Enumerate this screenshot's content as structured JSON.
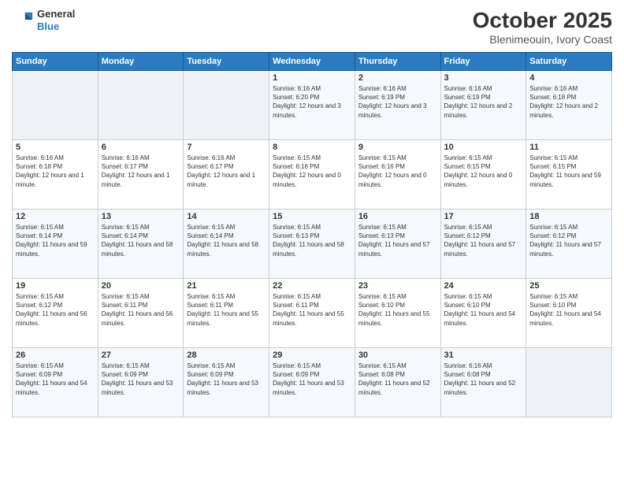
{
  "logo": {
    "general": "General",
    "blue": "Blue"
  },
  "title": "October 2025",
  "subtitle": "Blenimeouin, Ivory Coast",
  "weekdays": [
    "Sunday",
    "Monday",
    "Tuesday",
    "Wednesday",
    "Thursday",
    "Friday",
    "Saturday"
  ],
  "weeks": [
    [
      {
        "day": "",
        "info": ""
      },
      {
        "day": "",
        "info": ""
      },
      {
        "day": "",
        "info": ""
      },
      {
        "day": "1",
        "info": "Sunrise: 6:16 AM\nSunset: 6:20 PM\nDaylight: 12 hours and 3 minutes."
      },
      {
        "day": "2",
        "info": "Sunrise: 6:16 AM\nSunset: 6:19 PM\nDaylight: 12 hours and 3 minutes."
      },
      {
        "day": "3",
        "info": "Sunrise: 6:16 AM\nSunset: 6:19 PM\nDaylight: 12 hours and 2 minutes."
      },
      {
        "day": "4",
        "info": "Sunrise: 6:16 AM\nSunset: 6:18 PM\nDaylight: 12 hours and 2 minutes."
      }
    ],
    [
      {
        "day": "5",
        "info": "Sunrise: 6:16 AM\nSunset: 6:18 PM\nDaylight: 12 hours and 1 minute."
      },
      {
        "day": "6",
        "info": "Sunrise: 6:16 AM\nSunset: 6:17 PM\nDaylight: 12 hours and 1 minute."
      },
      {
        "day": "7",
        "info": "Sunrise: 6:16 AM\nSunset: 6:17 PM\nDaylight: 12 hours and 1 minute."
      },
      {
        "day": "8",
        "info": "Sunrise: 6:15 AM\nSunset: 6:16 PM\nDaylight: 12 hours and 0 minutes."
      },
      {
        "day": "9",
        "info": "Sunrise: 6:15 AM\nSunset: 6:16 PM\nDaylight: 12 hours and 0 minutes."
      },
      {
        "day": "10",
        "info": "Sunrise: 6:15 AM\nSunset: 6:15 PM\nDaylight: 12 hours and 0 minutes."
      },
      {
        "day": "11",
        "info": "Sunrise: 6:15 AM\nSunset: 6:15 PM\nDaylight: 11 hours and 59 minutes."
      }
    ],
    [
      {
        "day": "12",
        "info": "Sunrise: 6:15 AM\nSunset: 6:14 PM\nDaylight: 11 hours and 59 minutes."
      },
      {
        "day": "13",
        "info": "Sunrise: 6:15 AM\nSunset: 6:14 PM\nDaylight: 11 hours and 58 minutes."
      },
      {
        "day": "14",
        "info": "Sunrise: 6:15 AM\nSunset: 6:14 PM\nDaylight: 11 hours and 58 minutes."
      },
      {
        "day": "15",
        "info": "Sunrise: 6:15 AM\nSunset: 6:13 PM\nDaylight: 11 hours and 58 minutes."
      },
      {
        "day": "16",
        "info": "Sunrise: 6:15 AM\nSunset: 6:13 PM\nDaylight: 11 hours and 57 minutes."
      },
      {
        "day": "17",
        "info": "Sunrise: 6:15 AM\nSunset: 6:12 PM\nDaylight: 11 hours and 57 minutes."
      },
      {
        "day": "18",
        "info": "Sunrise: 6:15 AM\nSunset: 6:12 PM\nDaylight: 11 hours and 57 minutes."
      }
    ],
    [
      {
        "day": "19",
        "info": "Sunrise: 6:15 AM\nSunset: 6:12 PM\nDaylight: 11 hours and 56 minutes."
      },
      {
        "day": "20",
        "info": "Sunrise: 6:15 AM\nSunset: 6:11 PM\nDaylight: 11 hours and 56 minutes."
      },
      {
        "day": "21",
        "info": "Sunrise: 6:15 AM\nSunset: 6:11 PM\nDaylight: 11 hours and 55 minutes."
      },
      {
        "day": "22",
        "info": "Sunrise: 6:15 AM\nSunset: 6:11 PM\nDaylight: 11 hours and 55 minutes."
      },
      {
        "day": "23",
        "info": "Sunrise: 6:15 AM\nSunset: 6:10 PM\nDaylight: 11 hours and 55 minutes."
      },
      {
        "day": "24",
        "info": "Sunrise: 6:15 AM\nSunset: 6:10 PM\nDaylight: 11 hours and 54 minutes."
      },
      {
        "day": "25",
        "info": "Sunrise: 6:15 AM\nSunset: 6:10 PM\nDaylight: 11 hours and 54 minutes."
      }
    ],
    [
      {
        "day": "26",
        "info": "Sunrise: 6:15 AM\nSunset: 6:09 PM\nDaylight: 11 hours and 54 minutes."
      },
      {
        "day": "27",
        "info": "Sunrise: 6:15 AM\nSunset: 6:09 PM\nDaylight: 11 hours and 53 minutes."
      },
      {
        "day": "28",
        "info": "Sunrise: 6:15 AM\nSunset: 6:09 PM\nDaylight: 11 hours and 53 minutes."
      },
      {
        "day": "29",
        "info": "Sunrise: 6:15 AM\nSunset: 6:09 PM\nDaylight: 11 hours and 53 minutes."
      },
      {
        "day": "30",
        "info": "Sunrise: 6:15 AM\nSunset: 6:08 PM\nDaylight: 11 hours and 52 minutes."
      },
      {
        "day": "31",
        "info": "Sunrise: 6:16 AM\nSunset: 6:08 PM\nDaylight: 11 hours and 52 minutes."
      },
      {
        "day": "",
        "info": ""
      }
    ]
  ]
}
